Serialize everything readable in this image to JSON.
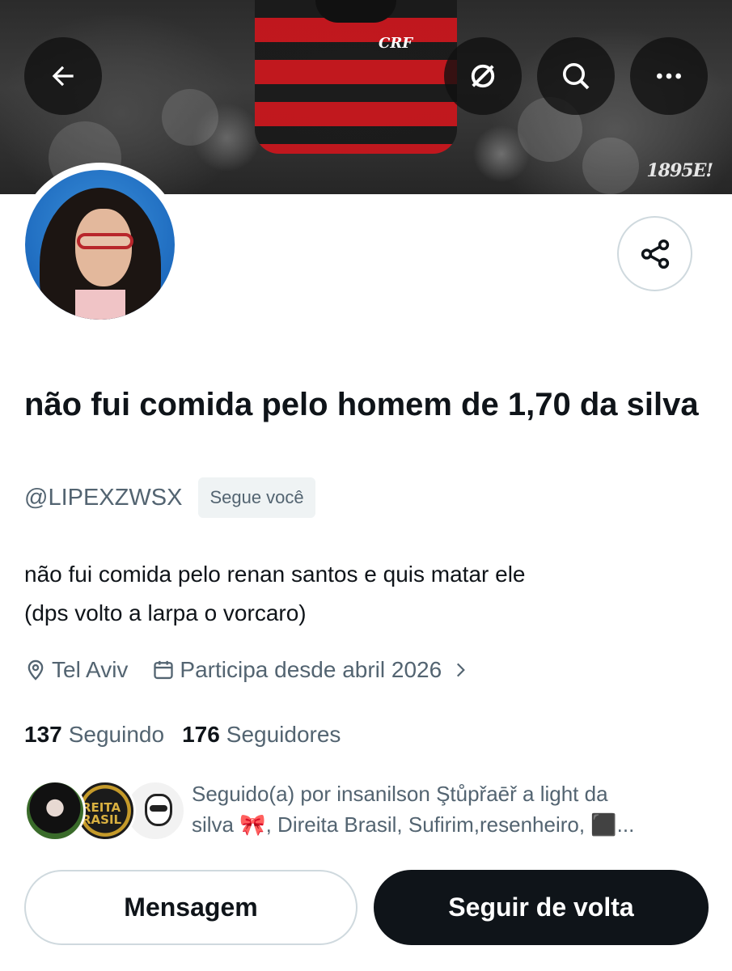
{
  "banner": {
    "watermark": "1895E!",
    "crest": "CRF"
  },
  "header": {
    "back_icon": "arrow-left-icon",
    "grok_icon": "grok-icon",
    "search_icon": "search-icon",
    "more_icon": "more-icon"
  },
  "profile": {
    "display_name": "não fui comida pelo homem de 1,70 da silva",
    "handle": "@LIPEXZWSX",
    "follows_you": "Segue você",
    "bio_line1": "não fui comida pelo renan santos e quis matar ele",
    "bio_line2": "(dps volto a larpa o vorcaro)",
    "location": "Tel Aviv",
    "joined": "Participa desde abril 2026",
    "following_count": "137",
    "following_label": "Seguindo",
    "followers_count": "176",
    "followers_label": "Seguidores",
    "followed_by_line1": "Seguido(a) por insanilson Ştůpřaēř a light da",
    "followed_by_line2": "silva 🎀, Direita Brasil, Sufirim,resenheiro, ⬛...",
    "mini_avatar_2_text": "REITA\nRASIL"
  },
  "actions": {
    "message_label": "Mensagem",
    "follow_back_label": "Seguir de volta"
  },
  "colors": {
    "primary_text": "#0f1419",
    "secondary_text": "#536471",
    "border": "#cfd9de",
    "follow_button_bg": "#0f1419"
  }
}
